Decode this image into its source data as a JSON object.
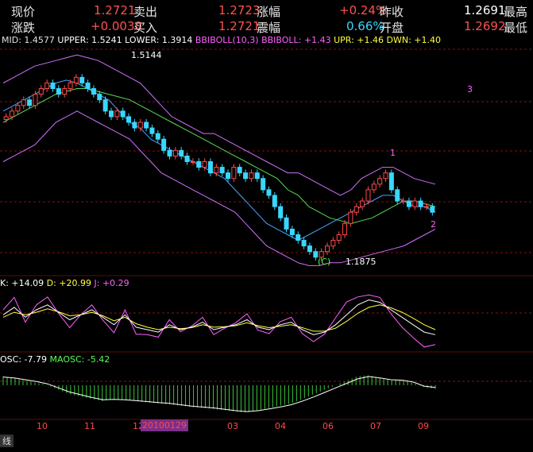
{
  "quote": {
    "items": [
      {
        "label": "现价",
        "value": "1.2721",
        "vcolor": "#ff5050"
      },
      {
        "label": "卖出",
        "value": "1.2723",
        "vcolor": "#ff5050"
      },
      {
        "label": "涨幅",
        "value": "+0.24%",
        "vcolor": "#ff5050"
      },
      {
        "label": "昨收",
        "value": "1.2691",
        "vcolor": "#ffffff"
      },
      {
        "label": "最高",
        "value": "",
        "vcolor": "#ffffff"
      },
      {
        "label": "涨跌",
        "value": "+0.0030",
        "vcolor": "#ff5050"
      },
      {
        "label": "买入",
        "value": "1.2721",
        "vcolor": "#ff5050"
      },
      {
        "label": "震幅",
        "value": "0.66%",
        "vcolor": "#38d7ff"
      },
      {
        "label": "开盘",
        "value": "1.2692",
        "vcolor": "#ff5050"
      },
      {
        "label": "最低",
        "value": "",
        "vcolor": "#ffffff"
      }
    ]
  },
  "boll": {
    "mid": "MID: 1.4577",
    "upper": "UPPER: 1.5241",
    "lower": "LOWER: 1.3914",
    "bbiboll": "BBIBOLL(10,3)",
    "bbiboll_val": "BBIBOLL: +1.43",
    "upr": "UPR: +1.46",
    "dwn": "DWN: +1.40"
  },
  "kdj": {
    "k": "K: +14.09",
    "d": "D: +20.99",
    "j": "J: +0.29"
  },
  "osc": {
    "osc": "OSC: -7.79",
    "maosc": "MAOSC: -5.42"
  },
  "annotations": {
    "high": "1.5144",
    "low": "1.1875",
    "wave_c": "(C)",
    "wave_1": "1",
    "wave_2": "2",
    "wave_3": "3"
  },
  "xaxis": {
    "ticks": [
      "10",
      "11",
      "12",
      "03",
      "04",
      "06",
      "07",
      "09"
    ],
    "date_label": "20100129"
  },
  "tab_label": "线",
  "colors": {
    "up": "#ff4a4a",
    "down": "#38d7ff",
    "mid": "#e0e0e0",
    "upper": "#ffffff",
    "lower": "#ffffff",
    "bbiboll": "#ff60ff",
    "upr": "#ffff40",
    "dwn": "#ffff40",
    "grid": "#8a1010",
    "osc": "#ffffff",
    "maosc": "#55ff55",
    "k": "#ffffff",
    "d": "#ffff40",
    "j": "#ff60ff"
  },
  "chart_data": {
    "type": "line",
    "title": "",
    "xlabel": "",
    "ylabel": "",
    "main": {
      "ylim": [
        1.16,
        1.56
      ],
      "close": [
        1.44,
        1.45,
        1.46,
        1.47,
        1.46,
        1.48,
        1.49,
        1.5,
        1.49,
        1.48,
        1.49,
        1.5,
        1.51,
        1.5,
        1.49,
        1.48,
        1.47,
        1.45,
        1.44,
        1.45,
        1.44,
        1.43,
        1.42,
        1.43,
        1.42,
        1.41,
        1.4,
        1.38,
        1.37,
        1.38,
        1.37,
        1.36,
        1.36,
        1.35,
        1.36,
        1.34,
        1.35,
        1.34,
        1.33,
        1.35,
        1.34,
        1.33,
        1.34,
        1.33,
        1.31,
        1.3,
        1.28,
        1.26,
        1.24,
        1.23,
        1.22,
        1.21,
        1.2,
        1.19,
        1.2,
        1.21,
        1.22,
        1.23,
        1.25,
        1.27,
        1.28,
        1.29,
        1.31,
        1.32,
        1.33,
        1.34,
        1.31,
        1.29,
        1.29,
        1.28,
        1.29,
        1.28,
        1.28,
        1.27
      ],
      "mid": [
        1.43,
        1.44,
        1.45,
        1.46,
        1.47,
        1.48,
        1.485,
        1.49,
        1.49,
        1.485,
        1.48,
        1.475,
        1.47,
        1.46,
        1.45,
        1.44,
        1.43,
        1.42,
        1.41,
        1.4,
        1.39,
        1.38,
        1.37,
        1.36,
        1.35,
        1.34,
        1.33,
        1.31,
        1.3,
        1.28,
        1.27,
        1.26,
        1.255,
        1.25,
        1.255,
        1.26,
        1.27,
        1.28,
        1.29,
        1.29,
        1.285,
        1.28
      ],
      "upper": [
        1.5,
        1.51,
        1.52,
        1.53,
        1.535,
        1.54,
        1.545,
        1.55,
        1.545,
        1.54,
        1.53,
        1.52,
        1.51,
        1.5,
        1.48,
        1.46,
        1.44,
        1.43,
        1.42,
        1.41,
        1.41,
        1.4,
        1.39,
        1.38,
        1.37,
        1.36,
        1.35,
        1.34,
        1.34,
        1.33,
        1.32,
        1.31,
        1.3,
        1.31,
        1.33,
        1.34,
        1.35,
        1.35,
        1.34,
        1.33,
        1.325,
        1.32
      ],
      "lower": [
        1.36,
        1.37,
        1.38,
        1.39,
        1.41,
        1.43,
        1.44,
        1.45,
        1.44,
        1.43,
        1.42,
        1.41,
        1.4,
        1.38,
        1.36,
        1.34,
        1.33,
        1.32,
        1.31,
        1.3,
        1.29,
        1.28,
        1.27,
        1.25,
        1.23,
        1.21,
        1.2,
        1.19,
        1.18,
        1.175,
        1.175,
        1.18,
        1.18,
        1.185,
        1.19,
        1.195,
        1.2,
        1.205,
        1.21,
        1.22,
        1.23,
        1.24
      ],
      "bbiboll": [
        1.45,
        1.46,
        1.47,
        1.48,
        1.49,
        1.5,
        1.505,
        1.5,
        1.49,
        1.48,
        1.47,
        1.45,
        1.43,
        1.42,
        1.4,
        1.39,
        1.38,
        1.37,
        1.36,
        1.35,
        1.34,
        1.33,
        1.31,
        1.29,
        1.27,
        1.25,
        1.24,
        1.23,
        1.22,
        1.23,
        1.24,
        1.25,
        1.26,
        1.27,
        1.28,
        1.29,
        1.3,
        1.3,
        1.29,
        1.28,
        1.28,
        1.27
      ]
    },
    "kdj": {
      "ylim": [
        -10,
        110
      ],
      "k": [
        60,
        75,
        55,
        70,
        80,
        65,
        50,
        60,
        70,
        55,
        40,
        60,
        35,
        30,
        25,
        40,
        30,
        35,
        45,
        30,
        35,
        40,
        50,
        35,
        30,
        40,
        45,
        30,
        20,
        25,
        40,
        60,
        80,
        90,
        85,
        70,
        55,
        40,
        25,
        20
      ],
      "d": [
        55,
        65,
        60,
        65,
        72,
        66,
        58,
        60,
        65,
        58,
        48,
        55,
        42,
        35,
        30,
        35,
        32,
        34,
        40,
        35,
        36,
        38,
        44,
        38,
        34,
        37,
        40,
        34,
        27,
        27,
        33,
        47,
        63,
        75,
        80,
        74,
        65,
        53,
        40,
        30
      ],
      "j": [
        70,
        95,
        45,
        80,
        96,
        63,
        34,
        60,
        80,
        49,
        24,
        70,
        21,
        20,
        15,
        50,
        26,
        37,
        55,
        20,
        33,
        44,
        62,
        29,
        22,
        46,
        55,
        22,
        6,
        21,
        54,
        86,
        96,
        100,
        95,
        62,
        35,
        14,
        -5,
        0
      ]
    },
    "osc": {
      "ylim": [
        -70,
        40
      ],
      "osc": [
        20,
        15,
        10,
        5,
        0,
        -10,
        -20,
        -25,
        -30,
        -35,
        -30,
        -32,
        -35,
        -38,
        -40,
        -42,
        -45,
        -48,
        -50,
        -52,
        -55,
        -58,
        -60,
        -55,
        -50,
        -45,
        -40,
        -30,
        -20,
        -10,
        0,
        10,
        20,
        22,
        15,
        10,
        12,
        5,
        -5,
        -8
      ],
      "maosc": [
        18,
        16,
        12,
        8,
        3,
        -6,
        -15,
        -21,
        -27,
        -32,
        -31,
        -32,
        -34,
        -36,
        -38,
        -40,
        -43,
        -46,
        -48,
        -50,
        -53,
        -56,
        -58,
        -56,
        -52,
        -48,
        -43,
        -35,
        -26,
        -16,
        -6,
        4,
        14,
        19,
        16,
        12,
        11,
        7,
        -2,
        -5
      ]
    }
  }
}
